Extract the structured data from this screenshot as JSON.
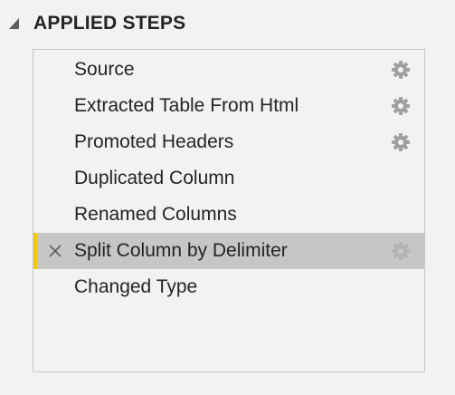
{
  "header": {
    "title": "APPLIED STEPS"
  },
  "steps": [
    {
      "label": "Source",
      "has_settings": true,
      "selected": false
    },
    {
      "label": "Extracted Table From Html",
      "has_settings": true,
      "selected": false
    },
    {
      "label": "Promoted Headers",
      "has_settings": true,
      "selected": false
    },
    {
      "label": "Duplicated Column",
      "has_settings": false,
      "selected": false
    },
    {
      "label": "Renamed Columns",
      "has_settings": false,
      "selected": false
    },
    {
      "label": "Split Column by Delimiter",
      "has_settings": true,
      "selected": true
    },
    {
      "label": "Changed Type",
      "has_settings": false,
      "selected": false
    }
  ],
  "icons": {
    "collapse": "collapse-triangle-icon",
    "settings": "gear-icon",
    "delete": "delete-x-icon"
  },
  "colors": {
    "background": "#f3f2f1",
    "selected_row": "#c8c6c4",
    "accent": "#f2c811",
    "gear": "#a19f9d",
    "text": "#252423"
  }
}
